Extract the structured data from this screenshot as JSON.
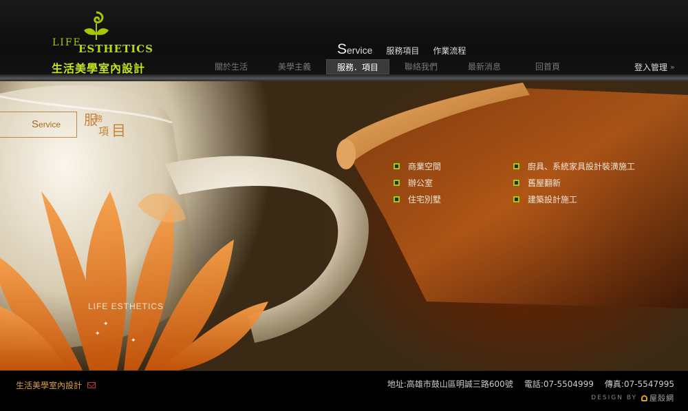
{
  "logo": {
    "life": "LIFE",
    "esthetics": "ESTHETICS",
    "name_cn": "生活美學室內設計"
  },
  "subnav": {
    "title_cap": "S",
    "title_rest": "ervice",
    "items": [
      "服務項目",
      "作業流程"
    ]
  },
  "mainnav": {
    "items": [
      "關於生活",
      "美學主義",
      "服務．項目",
      "聯絡我們",
      "最新消息",
      "回首頁"
    ],
    "active_index": 2
  },
  "login": {
    "label": "登入管理",
    "arrow": "»"
  },
  "hero": {
    "service_cap": "S",
    "service_rest": "ervice",
    "title_cn": [
      "服",
      "務",
      "項",
      "目"
    ],
    "services_col1": [
      "商業空間",
      "辦公室",
      "住宅別墅"
    ],
    "services_col2": [
      "廚具、系統家具設計裝潢施工",
      "舊屋翻新",
      "建築設計施工"
    ],
    "tagline": "LIFE   ESTHETICS"
  },
  "footer": {
    "name": "生活美學室內設計",
    "address": "地址:高雄市鼓山區明誠三路600號",
    "phone": "電話:07-5504999",
    "fax": "傳真:07-5547995",
    "design_by": "DESIGN BY",
    "designer": "屋殼網"
  },
  "colors": {
    "logo_green": "#b9dc10",
    "bullet_green": "#9acd1a",
    "accent_orange": "#c8833a",
    "footer_gold": "#d9a24a"
  },
  "icons": [
    "logo-swirl-icon",
    "bullet-square-icon",
    "mail-icon",
    "double-chevron-right-icon",
    "house-icon",
    "sparkle-icon"
  ]
}
